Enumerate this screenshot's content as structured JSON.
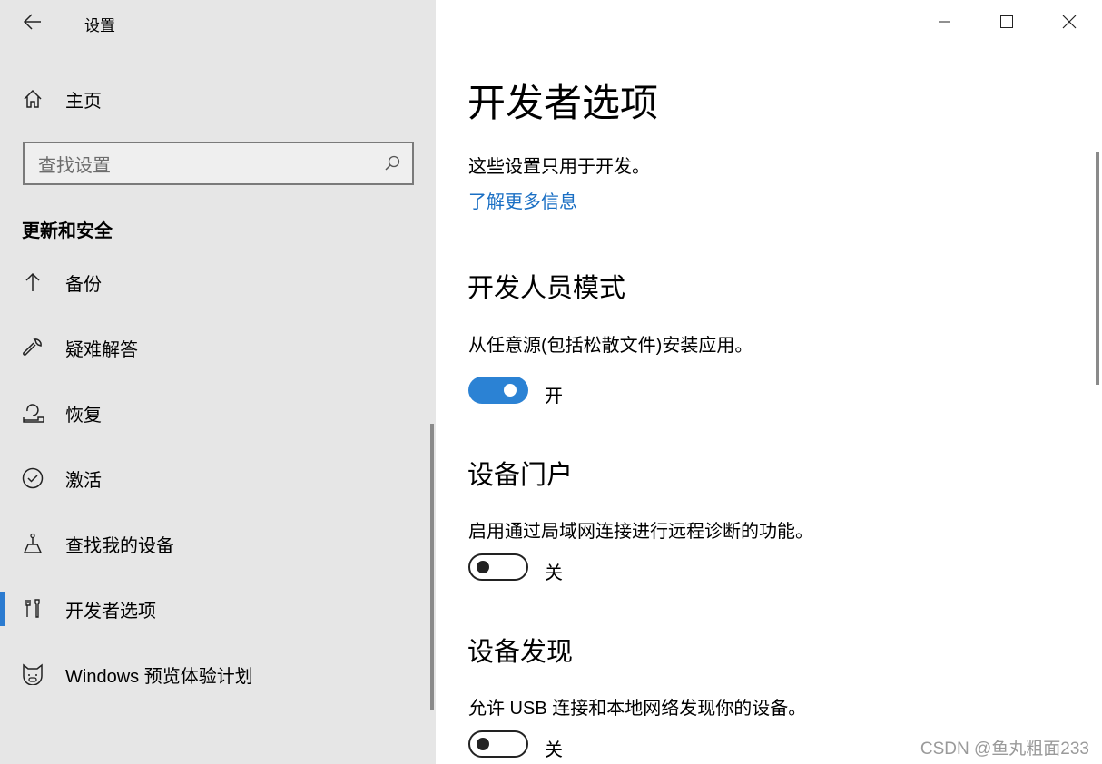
{
  "window": {
    "title": "设置"
  },
  "sidebar": {
    "home": "主页",
    "search": {
      "placeholder": "查找设置"
    },
    "section": "更新和安全",
    "items": [
      {
        "label": "备份",
        "icon": "backup-arrow-icon"
      },
      {
        "label": "疑难解答",
        "icon": "wrench-icon"
      },
      {
        "label": "恢复",
        "icon": "recovery-icon"
      },
      {
        "label": "激活",
        "icon": "check-circle-icon"
      },
      {
        "label": "查找我的设备",
        "icon": "find-device-icon"
      },
      {
        "label": "开发者选项",
        "icon": "developer-tools-icon",
        "active": true
      },
      {
        "label": "Windows 预览体验计划",
        "icon": "insider-cat-icon"
      }
    ]
  },
  "main": {
    "title": "开发者选项",
    "desc": "这些设置只用于开发。",
    "learn_more": "了解更多信息",
    "sections": [
      {
        "title": "开发人员模式",
        "desc": "从任意源(包括松散文件)安装应用。",
        "toggle_on": true,
        "state": "开"
      },
      {
        "title": "设备门户",
        "desc": "启用通过局域网连接进行远程诊断的功能。",
        "toggle_on": false,
        "state": "关"
      },
      {
        "title": "设备发现",
        "desc": "允许 USB 连接和本地网络发现你的设备。",
        "toggle_on": false,
        "state": "关"
      }
    ]
  },
  "watermark": "CSDN @鱼丸粗面233",
  "colors": {
    "accent": "#2b82d4",
    "sidebar_bg": "#e6e6e6",
    "link": "#1a6fc4"
  }
}
